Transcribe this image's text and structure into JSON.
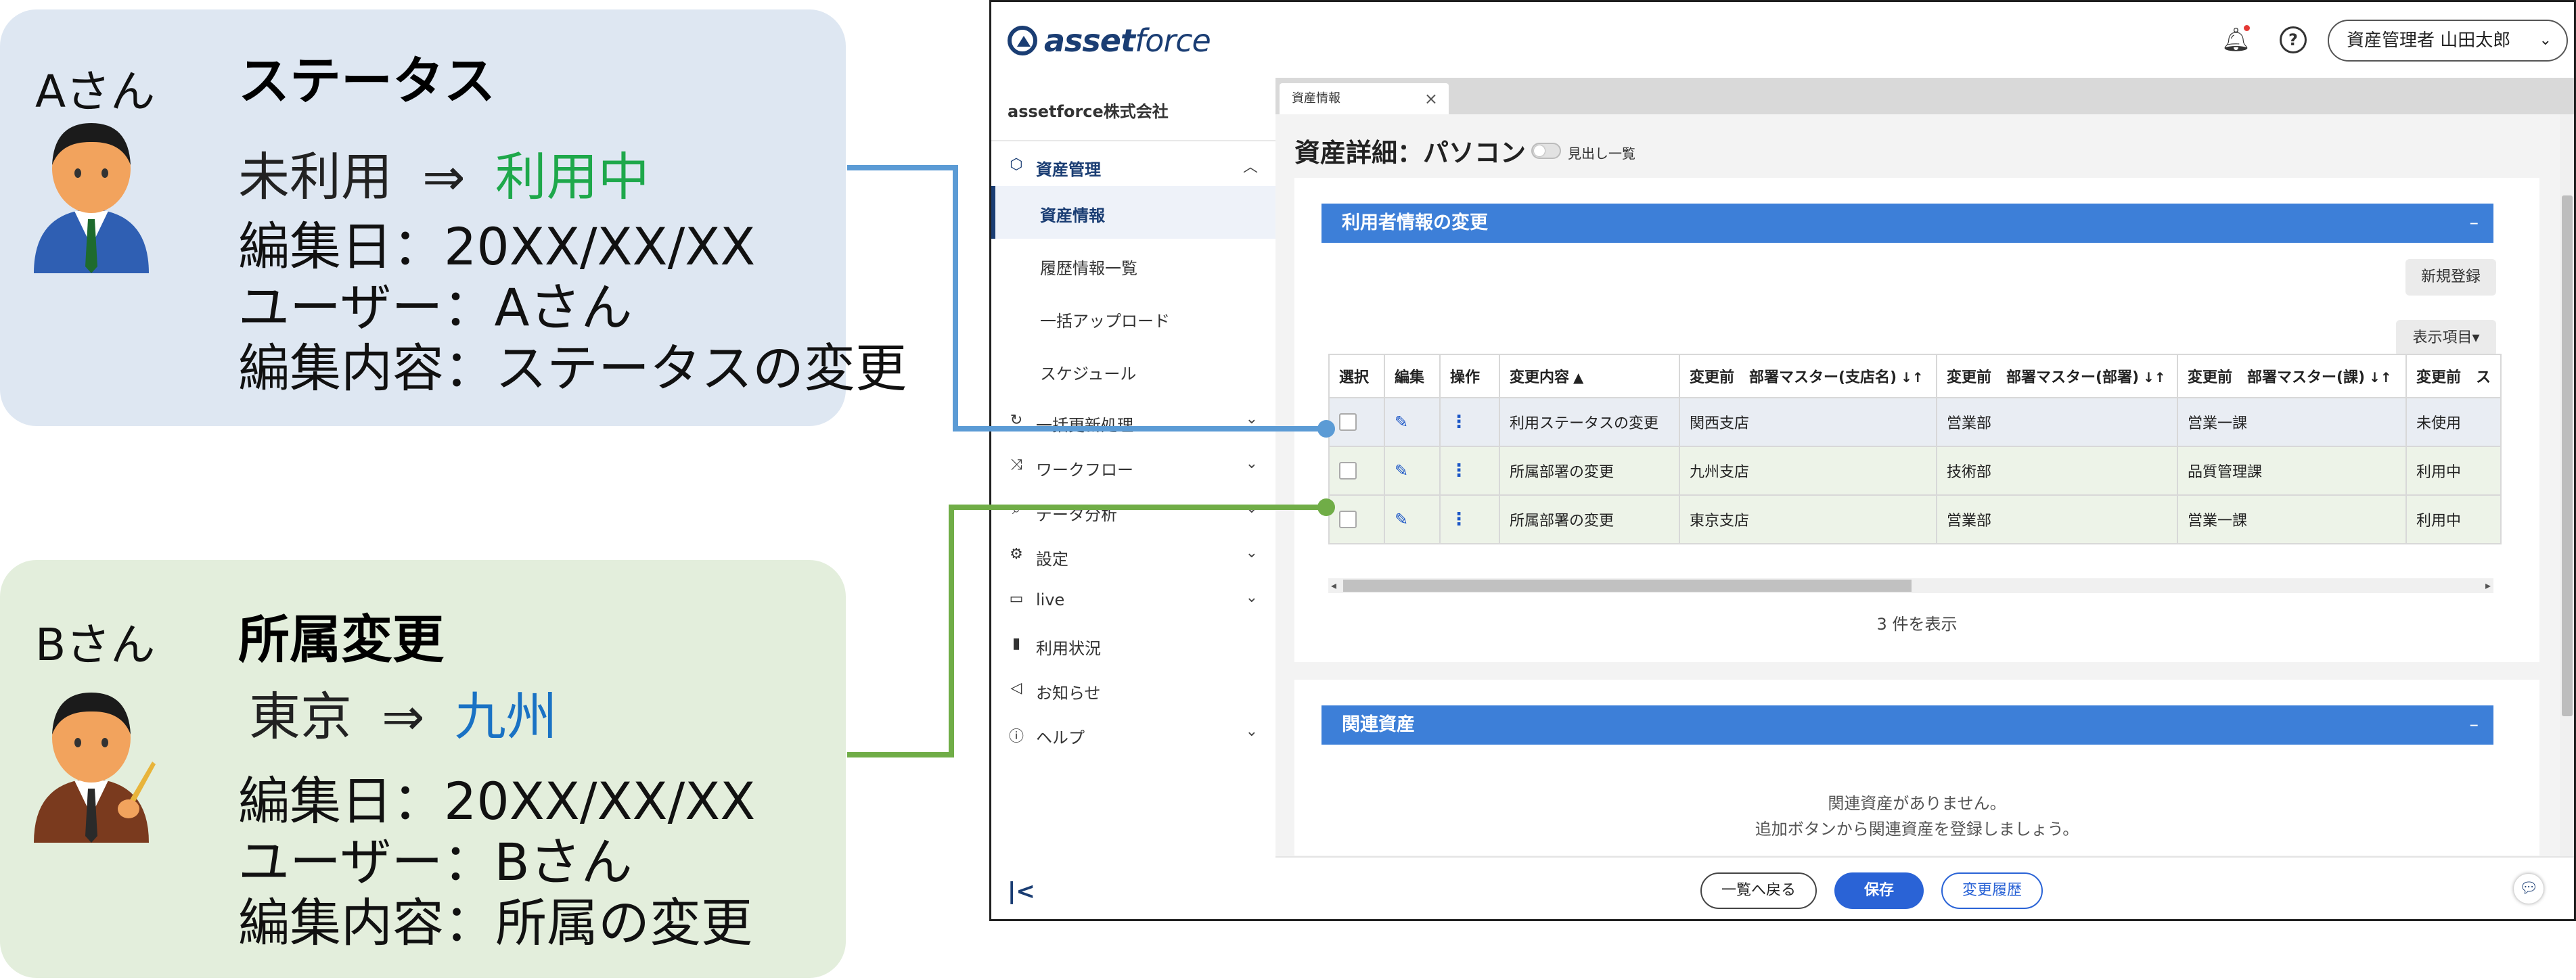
{
  "callout_a": {
    "who": "Aさん",
    "title": "ステータス",
    "change_from": "未利用",
    "arrow": "⇒",
    "change_to": "利用中",
    "change_to_color": "#1ea84b",
    "edit_date": "編集日：20XX/XX/XX",
    "user": "ユーザー：Aさん",
    "content": "編集内容：ステータスの変更"
  },
  "callout_b": {
    "who": "Bさん",
    "title": "所属変更",
    "change_from": "東京",
    "arrow": "⇒",
    "change_to": "九州",
    "change_to_color": "#1a72c4",
    "edit_date": "編集日：20XX/XX/XX",
    "user": "ユーザー：Bさん",
    "content": "編集内容：所属の変更"
  },
  "app": {
    "logo_bold": "asset",
    "logo_light": "force",
    "user_menu": "資産管理者 山田太郎",
    "company": "assetforce株式会社",
    "nav": {
      "asset_mgmt": "資産管理",
      "sub_items": [
        "資産情報",
        "履歴情報一覧",
        "一括アップロード",
        "スケジュール"
      ],
      "bulk_update": "一括更新処理",
      "workflow": "ワークフロー",
      "data_analysis": "データ分析",
      "settings": "設定",
      "live": "live",
      "usage": "利用状況",
      "notices": "お知らせ",
      "help": "ヘルプ"
    },
    "tab_label": "資産情報",
    "page_title": "資産詳細：パソコン",
    "toggle_label": "見出し一覧",
    "user_info_panel": {
      "title": "利用者情報の変更",
      "collapse": "–",
      "new_button": "新規登録",
      "display_button": "表示項目▾",
      "headers": [
        "選択",
        "編集",
        "操作",
        "変更内容",
        "変更前　部署マスター(支店名)",
        "変更前　部署マスター(部署)",
        "変更前　部署マスター(課)",
        "変更前　ス"
      ],
      "rows": [
        [
          "利用ステータスの変更",
          "関西支店",
          "営業部",
          "営業一課",
          "未使用"
        ],
        [
          "所属部署の変更",
          "九州支店",
          "技術部",
          "品質管理課",
          "利用中"
        ],
        [
          "所属部署の変更",
          "東京支店",
          "営業部",
          "営業一課",
          "利用中"
        ]
      ],
      "count_text": "3 件を表示"
    },
    "related_panel": {
      "title": "関連資産",
      "collapse": "–",
      "empty_line1": "関連資産がありません。",
      "empty_line2": "追加ボタンから関連資産を登録しましょう。"
    },
    "footer": {
      "back": "一覧へ戻る",
      "save": "保存",
      "history": "変更履歴"
    }
  },
  "colors": {
    "line_a": "#5b9bd5",
    "line_b": "#70ad47",
    "primary": "#2a63d6",
    "panel_header": "#3d7fd8"
  }
}
